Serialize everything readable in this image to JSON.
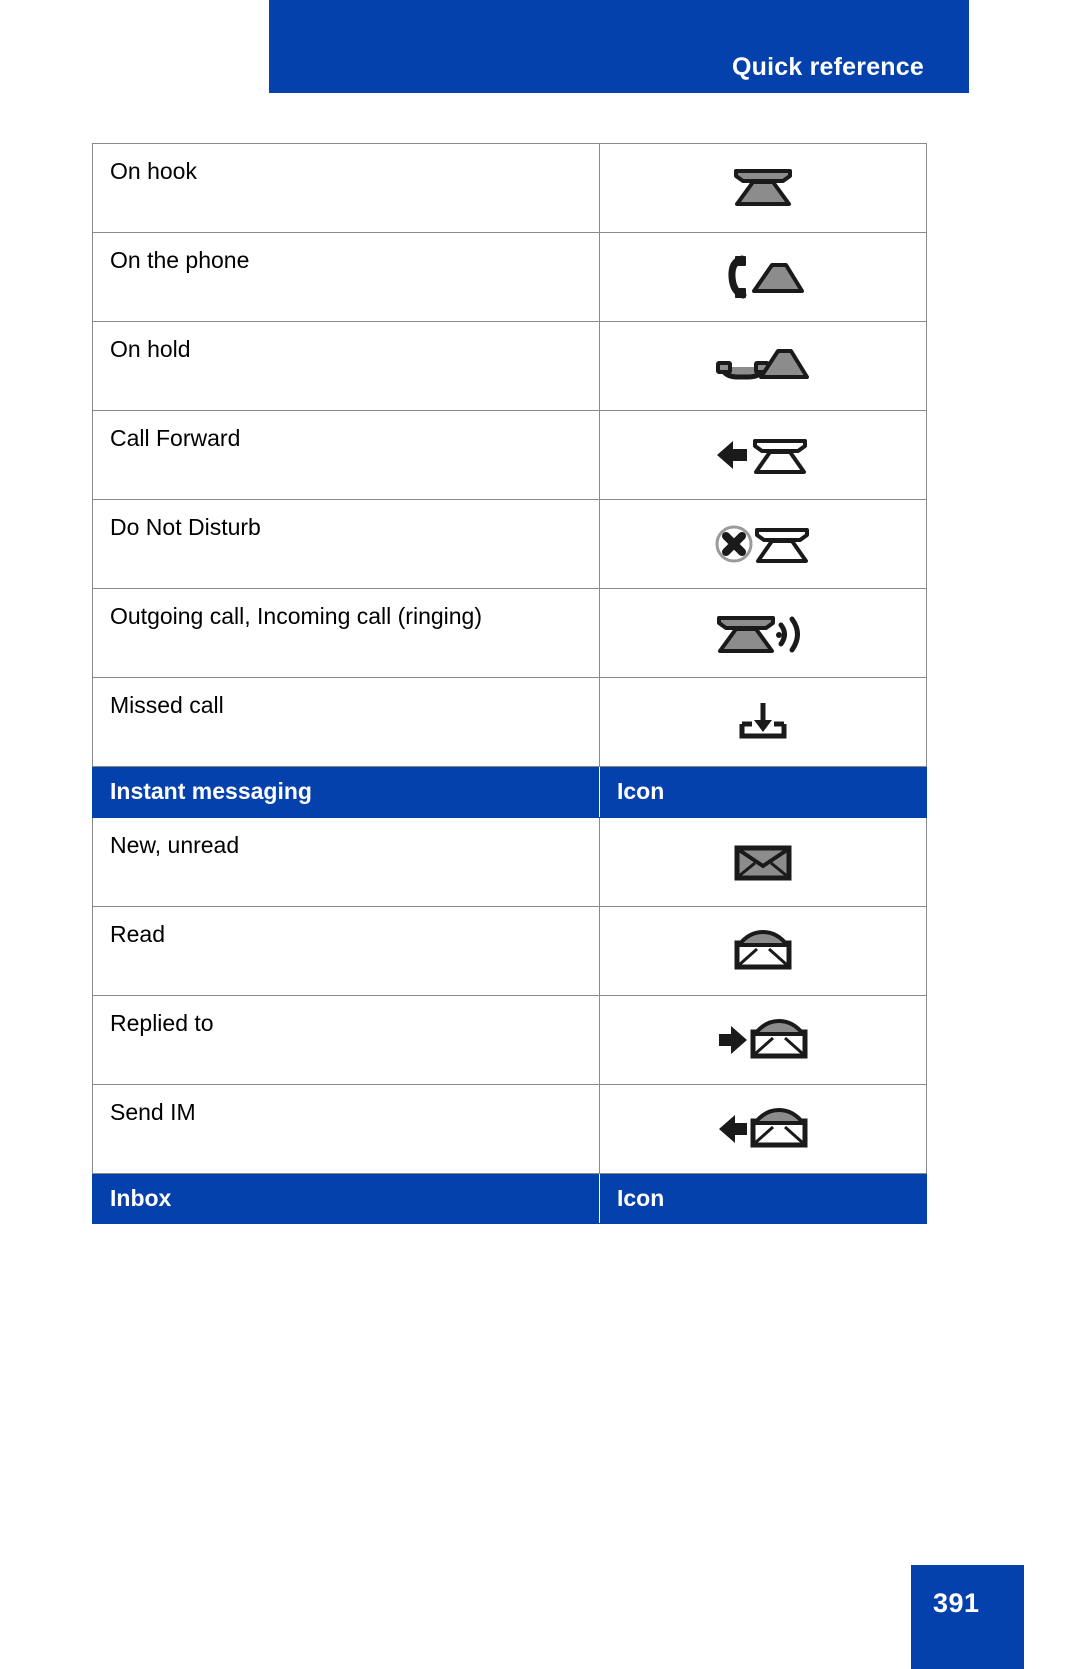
{
  "header": {
    "title": "Quick reference"
  },
  "footer": {
    "page_number": "391"
  },
  "colors": {
    "brand_blue": "#0541AC",
    "table_border": "#8a8a8a",
    "icon_gray": "#8c8c8c",
    "icon_black": "#1a1a1a",
    "text": "#000000",
    "header_text": "#ffffff"
  },
  "table": {
    "rows": [
      {
        "kind": "data",
        "label": "On hook",
        "icon": "phone-on-hook-icon"
      },
      {
        "kind": "data",
        "label": "On the phone",
        "icon": "phone-off-hook-icon"
      },
      {
        "kind": "data",
        "label": "On hold",
        "icon": "phone-on-hold-icon"
      },
      {
        "kind": "data",
        "label": "Call Forward",
        "icon": "call-forward-icon"
      },
      {
        "kind": "data",
        "label": "Do Not Disturb",
        "icon": "do-not-disturb-icon"
      },
      {
        "kind": "data",
        "label": "Outgoing call, Incoming call (ringing)",
        "icon": "phone-ringing-icon"
      },
      {
        "kind": "data",
        "label": "Missed call",
        "icon": "missed-call-icon"
      },
      {
        "kind": "section",
        "label": "Instant messaging",
        "icon_header": "Icon"
      },
      {
        "kind": "data",
        "label": "New, unread",
        "icon": "envelope-closed-icon"
      },
      {
        "kind": "data",
        "label": "Read",
        "icon": "envelope-open-icon"
      },
      {
        "kind": "data",
        "label": "Replied to",
        "icon": "envelope-replied-icon"
      },
      {
        "kind": "data",
        "label": "Send IM",
        "icon": "envelope-send-icon"
      },
      {
        "kind": "section",
        "label": "Inbox",
        "icon_header": "Icon"
      }
    ]
  }
}
